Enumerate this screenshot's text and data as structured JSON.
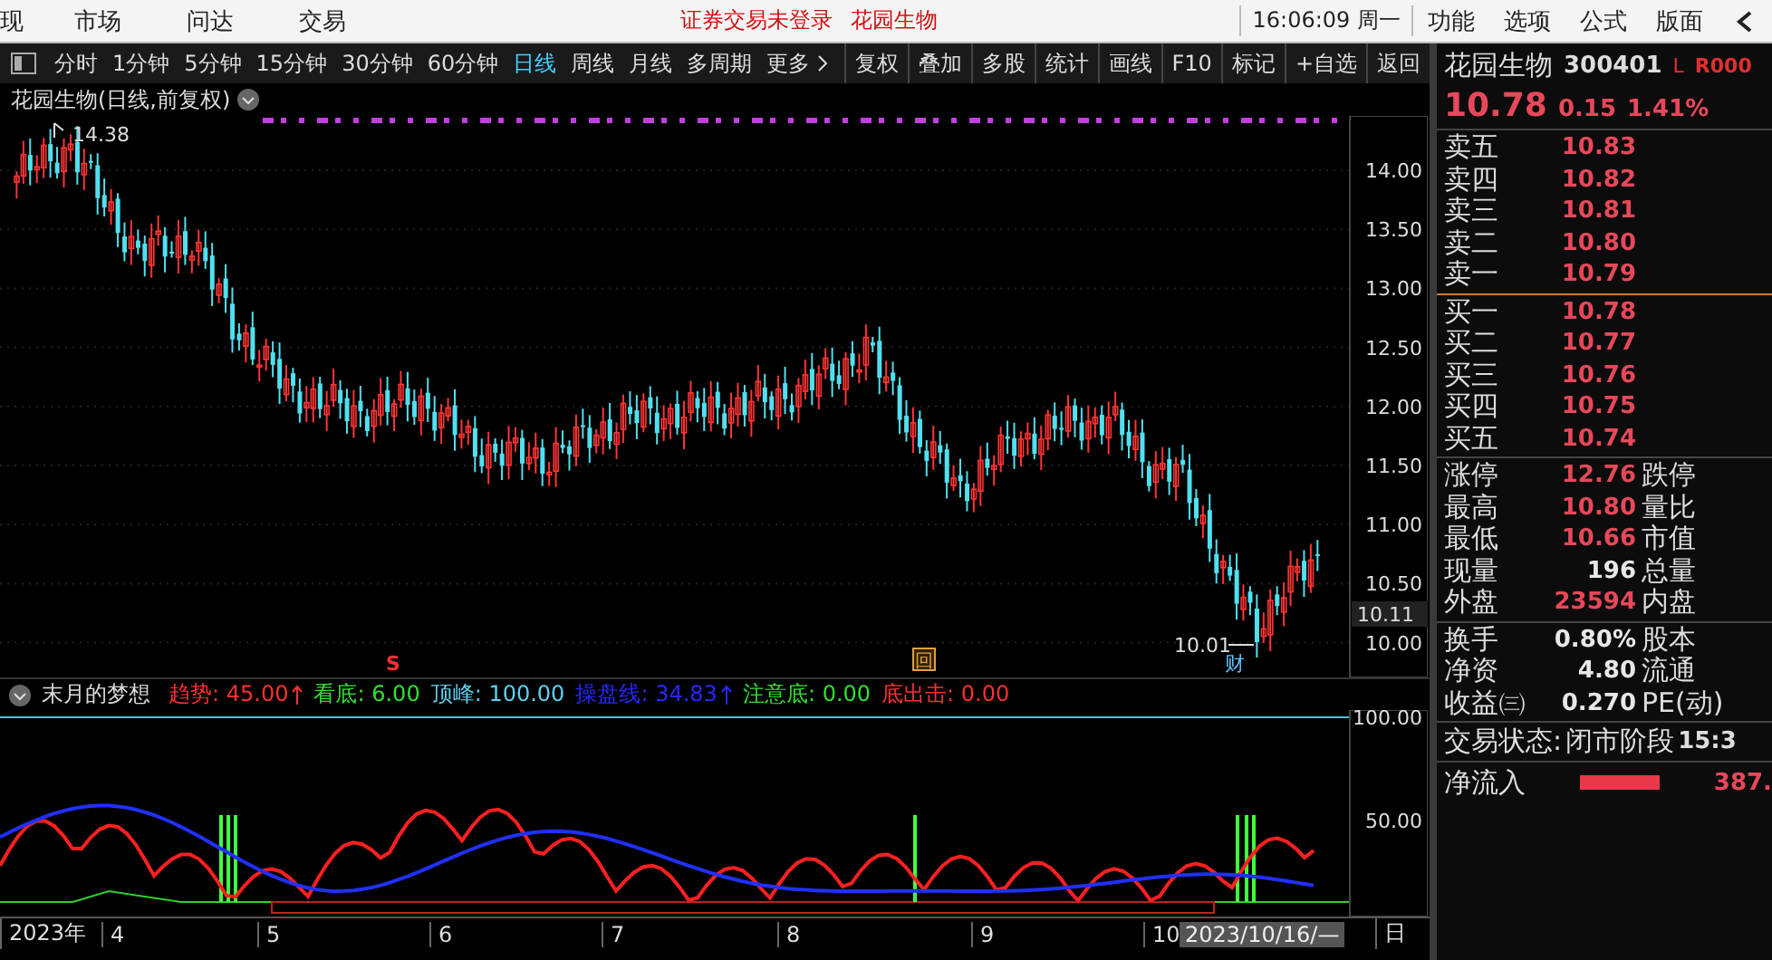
{
  "top_menu": {
    "cut_item": "现",
    "items": [
      "市场",
      "问达",
      "交易"
    ],
    "notice": [
      "证券交易未登录",
      "花园生物"
    ],
    "clock": "16:06:09 周一",
    "right_items": [
      "功能",
      "选项",
      "公式",
      "版面"
    ]
  },
  "toolbar": {
    "periods": [
      {
        "label": "分时",
        "selected": false
      },
      {
        "label": "1分钟",
        "selected": false
      },
      {
        "label": "5分钟",
        "selected": false
      },
      {
        "label": "15分钟",
        "selected": false
      },
      {
        "label": "30分钟",
        "selected": false
      },
      {
        "label": "60分钟",
        "selected": false
      },
      {
        "label": "日线",
        "selected": true
      },
      {
        "label": "周线",
        "selected": false
      },
      {
        "label": "月线",
        "selected": false
      },
      {
        "label": "多周期",
        "selected": false
      }
    ],
    "more": "更多",
    "buttons": [
      "复权",
      "叠加",
      "多股",
      "统计",
      "画线",
      "F10",
      "标记",
      "+自选",
      "返回"
    ]
  },
  "chart": {
    "title": "花园生物(日线,前复权)",
    "peak_label": "14.38",
    "low_label": "10.01",
    "price_axis": [
      "14.00",
      "13.50",
      "13.00",
      "12.50",
      "12.00",
      "11.50",
      "11.00",
      "10.50",
      "10.00"
    ],
    "current_price": "10.11",
    "markers": [
      {
        "kind": "signal",
        "text": "S"
      },
      {
        "kind": "box",
        "text": "回"
      },
      {
        "kind": "finance",
        "text": "财"
      }
    ]
  },
  "indicator": {
    "name": "末月的梦想",
    "items": [
      {
        "label": "趋势:",
        "value": "45.00",
        "color": "#ff3030",
        "arrow": true
      },
      {
        "label": "看底:",
        "value": "6.00",
        "color": "#30e030",
        "arrow": false
      },
      {
        "label": "顶峰:",
        "value": "100.00",
        "color": "#60d0f0",
        "arrow": false
      },
      {
        "label": "操盘线:",
        "value": "34.83",
        "color": "#2828ff",
        "arrow": true
      },
      {
        "label": "注意底:",
        "value": "0.00",
        "color": "#30e030",
        "arrow": false
      },
      {
        "label": "底出击:",
        "value": "0.00",
        "color": "#ff3030",
        "arrow": false
      }
    ],
    "axis": [
      "100.00",
      "50.00"
    ]
  },
  "time_axis": {
    "labels": [
      "2023年",
      "4",
      "5",
      "6",
      "7",
      "8",
      "9",
      "10"
    ],
    "cursor_date": "2023/10/16/—",
    "period_mark": "日"
  },
  "quote": {
    "name": "花园生物",
    "code": "300401",
    "flag_l": "L",
    "flag_r": "R000",
    "price": "10.78",
    "change": "0.15",
    "percent": "1.41%",
    "sells": [
      {
        "label": "卖五",
        "price": "10.83"
      },
      {
        "label": "卖四",
        "price": "10.82"
      },
      {
        "label": "卖三",
        "price": "10.81"
      },
      {
        "label": "卖二",
        "price": "10.80"
      },
      {
        "label": "卖一",
        "price": "10.79"
      }
    ],
    "buys": [
      {
        "label": "买一",
        "price": "10.78"
      },
      {
        "label": "买二",
        "price": "10.77"
      },
      {
        "label": "买三",
        "price": "10.76"
      },
      {
        "label": "买四",
        "price": "10.75"
      },
      {
        "label": "买五",
        "price": "10.74"
      }
    ],
    "stats": [
      {
        "label": "涨停",
        "value": "12.76",
        "color": "#e8485a",
        "label2": "跌停"
      },
      {
        "label": "最高",
        "value": "10.80",
        "color": "#e8485a",
        "label2": "量比"
      },
      {
        "label": "最低",
        "value": "10.66",
        "color": "#e8485a",
        "label2": "市值"
      },
      {
        "label": "现量",
        "value": "196",
        "color": "#e8e8e8",
        "label2": "总量"
      },
      {
        "label": "外盘",
        "value": "23594",
        "color": "#e8485a",
        "label2": "内盘"
      }
    ],
    "funds": [
      {
        "label": "换手",
        "value": "0.80%",
        "label2": "股本"
      },
      {
        "label": "净资",
        "value": "4.80",
        "label2": "流通"
      },
      {
        "label": "收益㈢",
        "value": "0.270",
        "label2": "PE(动)"
      }
    ],
    "status_label": "交易状态:",
    "status_value": "闭市阶段",
    "status_time": "15:3",
    "inflow_label": "净流入",
    "inflow_value": "387."
  }
}
